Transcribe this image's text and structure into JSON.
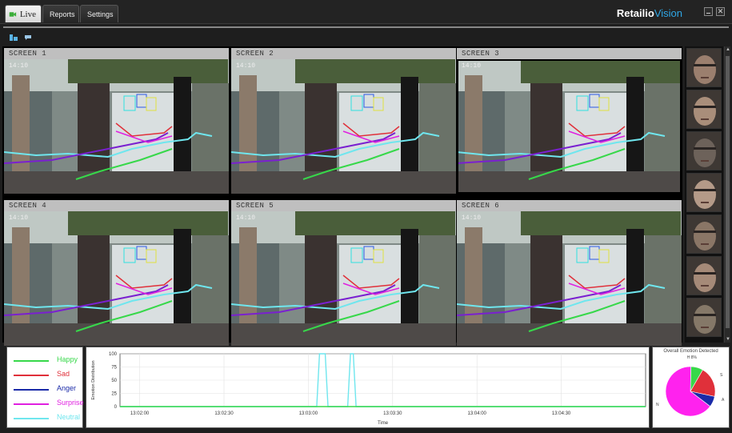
{
  "tabs": [
    {
      "label": "Live",
      "icon": "camera-icon",
      "active": true
    },
    {
      "label": "Reports",
      "icon": "report-icon",
      "active": false
    },
    {
      "label": "Settings",
      "icon": "gear-icon",
      "active": false
    }
  ],
  "brand": {
    "name": "Retailio",
    "accent": "Vision"
  },
  "window_controls": {
    "close_glyph": "✕"
  },
  "screens": [
    {
      "label": "SCREEN 1"
    },
    {
      "label": "SCREEN 2"
    },
    {
      "label": "SCREEN 3"
    },
    {
      "label": "SCREEN 4"
    },
    {
      "label": "SCREEN 5"
    },
    {
      "label": "SCREEN 6"
    }
  ],
  "camera_overlay_text": "14:10",
  "legend": [
    {
      "label": "Happy",
      "color": "#37d84a"
    },
    {
      "label": "Sad",
      "color": "#e0303a"
    },
    {
      "label": "Anger",
      "color": "#1a2aa8"
    },
    {
      "label": "Surprise",
      "color": "#e020e0"
    },
    {
      "label": "Neutral",
      "color": "#6fe6ee"
    }
  ],
  "chart_data": {
    "type": "line",
    "xlabel": "Time",
    "ylabel": "Emotion Distribution",
    "ylim": [
      0,
      100
    ],
    "yticks": [
      "0",
      "25",
      "50",
      "75",
      "100"
    ],
    "xticks": [
      "13:02:00",
      "13:02:30",
      "13:03:00",
      "13:03:30",
      "13:04:00",
      "13:04:30"
    ],
    "xlim_seconds": [
      0,
      187
    ],
    "series": [
      {
        "name": "Neutral",
        "color": "#6fe6ee",
        "points": [
          [
            0,
            0
          ],
          [
            70,
            0
          ],
          [
            71,
            100
          ],
          [
            73,
            100
          ],
          [
            74,
            0
          ],
          [
            81,
            0
          ],
          [
            82,
            100
          ],
          [
            83,
            100
          ],
          [
            84,
            0
          ],
          [
            187,
            0
          ]
        ]
      },
      {
        "name": "Happy",
        "color": "#37d84a",
        "points": [
          [
            0,
            0
          ],
          [
            187,
            0
          ]
        ]
      }
    ]
  },
  "pie": {
    "title": "Overall Emotion Detected",
    "slices": [
      {
        "label": "H",
        "value": 0.08,
        "color": "#37d84a"
      },
      {
        "label": "S",
        "value": 0.2,
        "color": "#e0303a"
      },
      {
        "label": "A",
        "value": 0.07,
        "color": "#1a2aa8"
      },
      {
        "label": "Su",
        "value": 0.65,
        "color": "#ff22ee"
      }
    ],
    "labels": [
      "H 8%",
      "S",
      "A",
      "N"
    ]
  }
}
